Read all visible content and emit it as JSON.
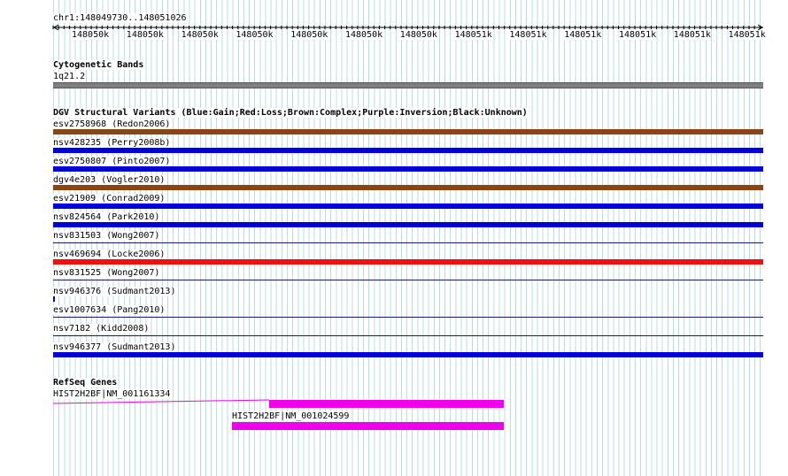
{
  "ruler": {
    "position": "chr1:148049730..148051026",
    "ticks": [
      "148050k",
      "148050k",
      "148050k",
      "148050k",
      "148050k",
      "148050k",
      "148050k",
      "148051k",
      "148051k",
      "148051k",
      "148051k",
      "148051k",
      "148051k"
    ]
  },
  "cytobands": {
    "title": "Cytogenetic Bands",
    "band": "1q21.2",
    "color": "#7f7f7f"
  },
  "dgv": {
    "title": "DGV Structural Variants (Blue:Gain;Red:Loss;Brown:Complex;Purple:Inversion;Black:Unknown)",
    "colors": {
      "gain": "#0000dd",
      "loss": "#ee1111",
      "complex": "#8b4513",
      "line": "#1a1a6e"
    },
    "variants": [
      {
        "label": "esv2758968 (Redon2006)",
        "kind": "complex"
      },
      {
        "label": "nsv428235 (Perry2008b)",
        "kind": "gain"
      },
      {
        "label": "esv2750807 (Pinto2007)",
        "kind": "gain"
      },
      {
        "label": "dgv4e203 (Vogler2010)",
        "kind": "complex"
      },
      {
        "label": "esv21909 (Conrad2009)",
        "kind": "gain"
      },
      {
        "label": "nsv824564 (Park2010)",
        "kind": "gain"
      },
      {
        "label": "nsv831503 (Wong2007)",
        "kind": "line"
      },
      {
        "label": "nsv469694 (Locke2006)",
        "kind": "loss"
      },
      {
        "label": "nsv831525 (Wong2007)",
        "kind": "line"
      },
      {
        "label": "nsv946376 (Sudmant2013)",
        "kind": "small"
      },
      {
        "label": "esv1007634 (Pang2010)",
        "kind": "line"
      },
      {
        "label": "nsv7182 (Kidd2008)",
        "kind": "line"
      },
      {
        "label": "nsv946377 (Sudmant2013)",
        "kind": "gain"
      }
    ]
  },
  "refseq": {
    "title": "RefSeq Genes",
    "color": "#ee00ee",
    "genes": [
      {
        "label": "HIST2H2BF|NM_001161334"
      },
      {
        "label": "HIST2H2BF|NM_001024599"
      }
    ]
  }
}
